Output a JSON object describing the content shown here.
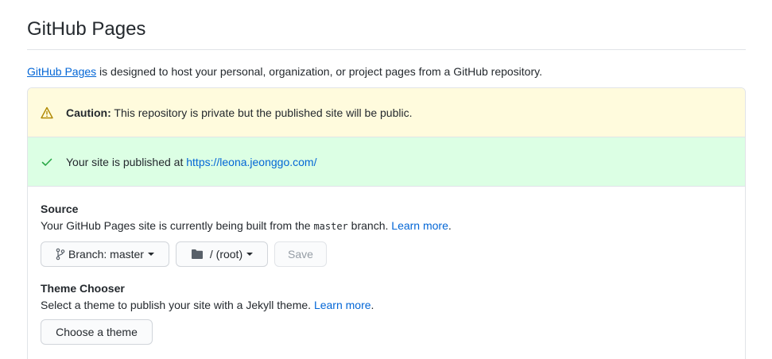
{
  "page": {
    "title": "GitHub Pages"
  },
  "intro": {
    "link_text": "GitHub Pages",
    "text": " is designed to host your personal, organization, or project pages from a GitHub repository."
  },
  "caution": {
    "label": "Caution:",
    "text": " This repository is private but the published site will be public."
  },
  "published": {
    "text": "Your site is published at ",
    "url": "https://leona.jeonggo.com/"
  },
  "source": {
    "title": "Source",
    "desc_before": "Your GitHub Pages site is currently being built from the ",
    "branch_code": "master",
    "desc_after": " branch. ",
    "learn_more": "Learn more",
    "period": ".",
    "branch_button": "Branch: master",
    "folder_button": "/ (root)",
    "save_button": "Save"
  },
  "theme": {
    "title": "Theme Chooser",
    "desc": "Select a theme to publish your site with a Jekyll theme. ",
    "learn_more": "Learn more",
    "period": ".",
    "choose_button": "Choose a theme"
  },
  "colors": {
    "link": "#0366d6",
    "warn_bg": "#fffbdd",
    "success_bg": "#dcffe4",
    "success_icon": "#28a745",
    "warn_icon": "#b08800"
  },
  "icons": {
    "warning": "alert-icon",
    "success": "check-icon",
    "branch": "git-branch-icon",
    "folder": "folder-icon"
  }
}
